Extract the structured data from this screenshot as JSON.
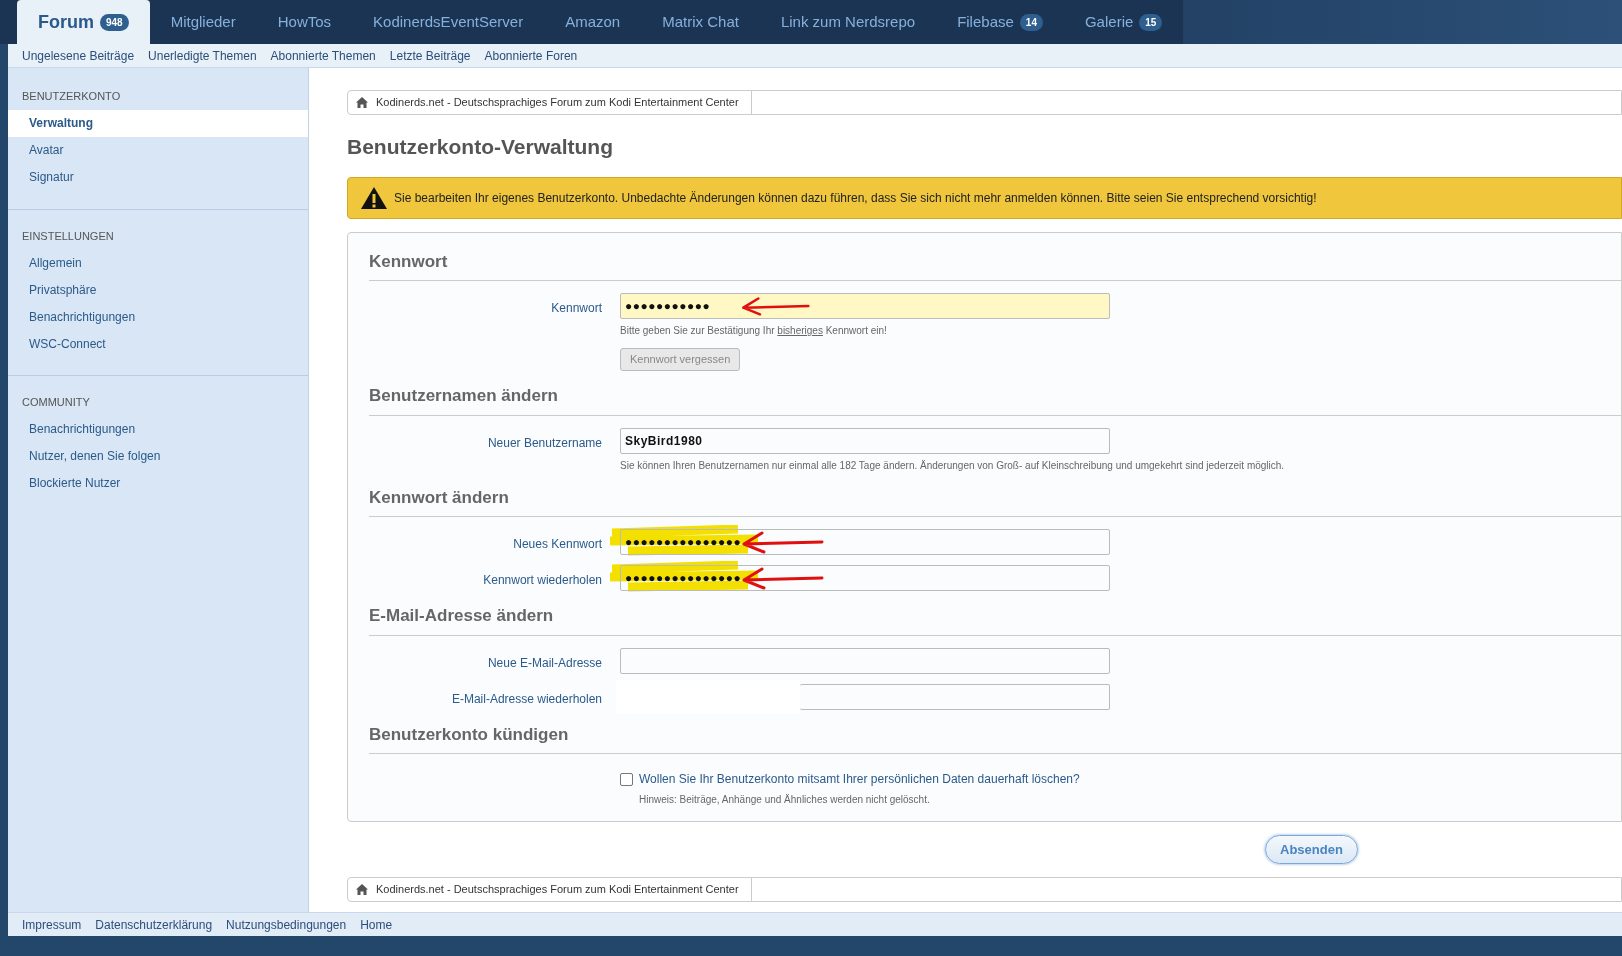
{
  "main_nav": [
    {
      "label": "Forum",
      "badge": "948",
      "selected": true
    },
    {
      "label": "Mitglieder",
      "selected": false
    },
    {
      "label": "HowTos",
      "selected": false
    },
    {
      "label": "KodinerdsEventServer",
      "selected": false
    },
    {
      "label": "Amazon",
      "selected": false
    },
    {
      "label": "Matrix Chat",
      "selected": false
    },
    {
      "label": "Link zum Nerdsrepo",
      "selected": false
    },
    {
      "label": "Filebase",
      "badge": "14",
      "selected": false
    },
    {
      "label": "Galerie",
      "badge": "15",
      "selected": false
    }
  ],
  "sub_nav": [
    "Ungelesene Beiträge",
    "Unerledigte Themen",
    "Abonnierte Themen",
    "Letzte Beiträge",
    "Abonnierte Foren"
  ],
  "sidebar": [
    {
      "heading": "BENUTZERKONTO",
      "items": [
        {
          "label": "Verwaltung",
          "selected": true
        },
        {
          "label": "Avatar",
          "selected": false
        },
        {
          "label": "Signatur",
          "selected": false
        }
      ]
    },
    {
      "heading": "EINSTELLUNGEN",
      "items": [
        {
          "label": "Allgemein",
          "selected": false
        },
        {
          "label": "Privatsphäre",
          "selected": false
        },
        {
          "label": "Benachrichtigungen",
          "selected": false
        },
        {
          "label": "WSC-Connect",
          "selected": false
        }
      ]
    },
    {
      "heading": "COMMUNITY",
      "items": [
        {
          "label": "Benachrichtigungen",
          "selected": false
        },
        {
          "label": "Nutzer, denen Sie folgen",
          "selected": false
        },
        {
          "label": "Blockierte Nutzer",
          "selected": false
        }
      ]
    }
  ],
  "breadcrumb_top": "Kodinerds.net - Deutschsprachiges Forum zum Kodi Entertainment Center",
  "breadcrumb_bottom": "Kodinerds.net - Deutschsprachiges Forum zum Kodi Entertainment Center",
  "title": "Benutzerkonto-Verwaltung",
  "warning": "Sie bearbeiten Ihr eigenes Benutzerkonto. Unbedachte Änderungen können dazu führen, dass Sie sich nicht mehr anmelden können. Bitte seien Sie entsprechend vorsichtig!",
  "sections": [
    {
      "title": "Kennwort",
      "fields": [
        {
          "label": "Kennwort",
          "value": "●●●●●●●●●●●",
          "highlighted": true,
          "annotated": true,
          "help_before": "Bitte geben Sie zur Bestätigung Ihr ",
          "help_link": "bisheriges",
          "help_after": " Kennwort ein!",
          "button": "Kennwort vergessen"
        }
      ]
    },
    {
      "title": "Benutzernamen ändern",
      "fields": [
        {
          "label": "Neuer Benutzername",
          "value": "SkyBird1980",
          "highlighted": false,
          "annotated": false,
          "help": "Sie können Ihren Benutzernamen nur einmal alle 182 Tage ändern. Änderungen von Groß- auf Kleinschreibung und umgekehrt sind jederzeit möglich."
        }
      ]
    },
    {
      "title": "Kennwort ändern",
      "fields": [
        {
          "label": "Neues Kennwort",
          "value": "●●●●●●●●●●●●●●●",
          "highlighted": false,
          "annotated": true
        },
        {
          "label": "Kennwort wiederholen",
          "value": "●●●●●●●●●●●●●●●",
          "highlighted": false,
          "annotated": true
        }
      ]
    },
    {
      "title": "E-Mail-Adresse ändern",
      "fields": [
        {
          "label": "Neue E-Mail-Adresse",
          "highlighted": false,
          "annotated": false
        },
        {
          "label": "E-Mail-Adresse wiederholen",
          "highlighted": false,
          "annotated": false,
          "redacted": true
        }
      ]
    },
    {
      "title": "Benutzerkonto kündigen",
      "checkbox": {
        "label": "Wollen Sie Ihr Benutzerkonto mitsamt Ihrer persönlichen Daten dauerhaft löschen?",
        "checked": false,
        "hint": "Hinweis: Beiträge, Anhänge und Ähnliches werden nicht gelöscht."
      }
    }
  ],
  "submit": "Absenden",
  "footer_links": [
    "Impressum",
    "Datenschutzerklärung",
    "Nutzungsbedingungen",
    "Home"
  ]
}
